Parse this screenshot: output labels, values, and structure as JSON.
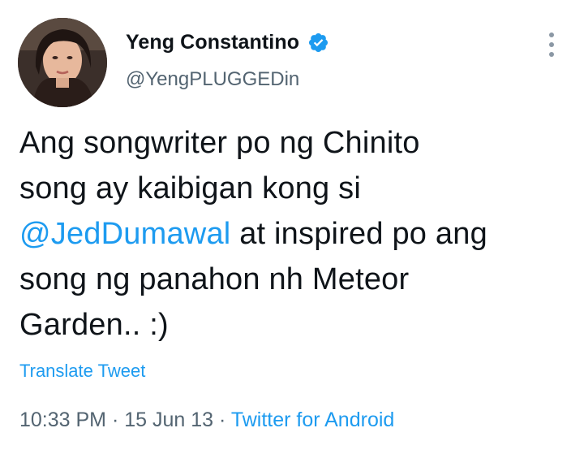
{
  "author": {
    "display_name": "Yeng Constantino",
    "handle": "@YengPLUGGEDin",
    "verified_icon": "verified-badge-icon"
  },
  "tweet": {
    "lines": [
      {
        "text": "Ang songwriter po ng Chinito"
      },
      {
        "text": "song ay kaibigan kong si"
      },
      {
        "mention": "@JedDumawal",
        "text": " at inspired po ang"
      },
      {
        "text": "song ng panahon nh Meteor"
      },
      {
        "text": "Garden.. :)"
      }
    ]
  },
  "translate_label": "Translate Tweet",
  "meta": {
    "time": "10:33 PM",
    "separator": " · ",
    "date": "15 Jun 13",
    "source": "Twitter for Android"
  },
  "colors": {
    "accent": "#1d9bf0",
    "text": "#0f1419",
    "secondary": "#536471"
  }
}
